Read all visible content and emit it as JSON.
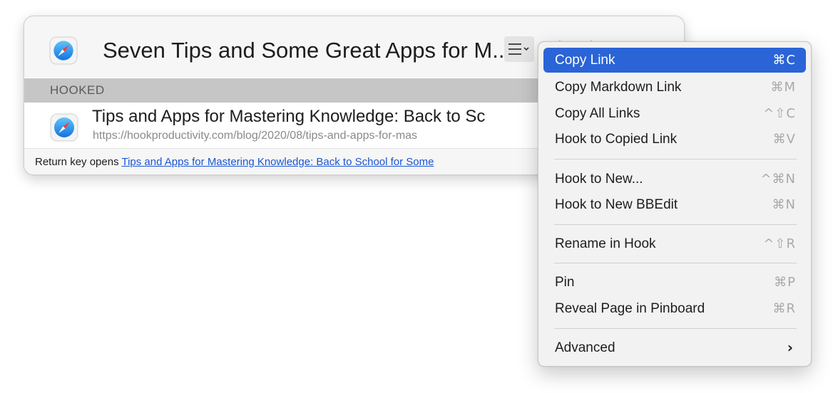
{
  "window": {
    "title": "Seven Tips and Some Great Apps for M...",
    "section_label": "HOOKED",
    "item": {
      "title": "Tips and Apps for Mastering Knowledge: Back to Sc",
      "url": "https://hookproductivity.com/blog/2020/08/tips-and-apps-for-mas"
    },
    "footer": {
      "prefix": "Return key opens ",
      "link_text": "Tips and Apps for Mastering Knowledge: Back to School for Some"
    },
    "icons": {
      "app_icon": "safari-compass-icon",
      "menu_trigger": "list-menu-icon",
      "ghost": [
        "gear-icon",
        "gear-icon",
        "search-icon"
      ]
    }
  },
  "menu": {
    "items": [
      {
        "label": "Copy Link",
        "shortcut": "⌘C",
        "selected": true
      },
      {
        "label": "Copy Markdown Link",
        "shortcut": "⌘M"
      },
      {
        "label": "Copy All Links",
        "shortcut": "^⇧C"
      },
      {
        "label": "Hook to Copied Link",
        "shortcut": "⌘V"
      },
      {
        "label": "Hook to New...",
        "shortcut": "^⌘N"
      },
      {
        "label": "Hook to New BBEdit",
        "shortcut": "⌘N"
      },
      {
        "label": "Rename in Hook",
        "shortcut": "^⇧R"
      },
      {
        "label": "Pin",
        "shortcut": "⌘P"
      },
      {
        "label": "Reveal Page in Pinboard",
        "shortcut": "⌘R"
      },
      {
        "label": "Advanced",
        "submenu": true
      }
    ]
  },
  "colors": {
    "selection": "#2a64d6",
    "link": "#1a55d4",
    "section_header": "#c6c6c6",
    "shortcut_gray": "#a9a9a9"
  }
}
